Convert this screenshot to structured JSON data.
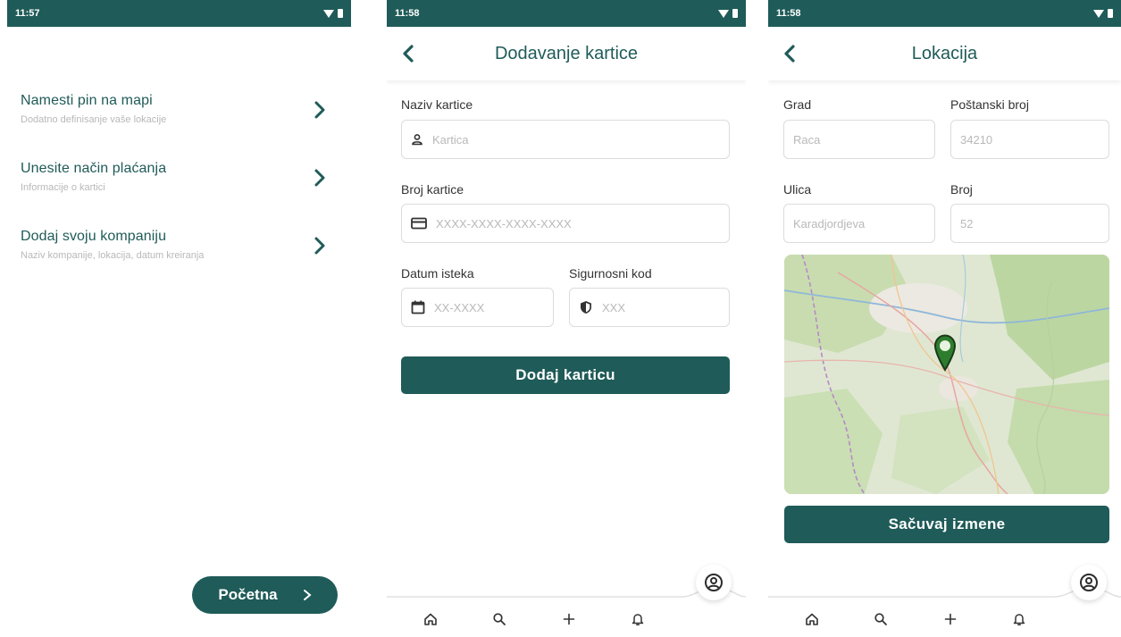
{
  "screen1": {
    "status_time": "11:57",
    "items": [
      {
        "title": "Namesti pin na mapi",
        "subtitle": "Dodatno definisanje vaše lokacije"
      },
      {
        "title": "Unesite način plaćanja",
        "subtitle": "Informacije o kartici"
      },
      {
        "title": "Dodaj svoju kompaniju",
        "subtitle": "Naziv kompanije, lokacija, datum kreiranja"
      }
    ],
    "home_button": "Početna"
  },
  "screen2": {
    "status_time": "11:58",
    "title": "Dodavanje kartice",
    "card_name_label": "Naziv kartice",
    "card_name_placeholder": "Kartica",
    "card_number_label": "Broj kartice",
    "card_number_placeholder": "XXXX-XXXX-XXXX-XXXX",
    "expiry_label": "Datum isteka",
    "expiry_placeholder": "XX-XXXX",
    "cvv_label": "Sigurnosni kod",
    "cvv_placeholder": "XXX",
    "submit_label": "Dodaj karticu"
  },
  "screen3": {
    "status_time": "11:58",
    "title": "Lokacija",
    "city_label": "Grad",
    "city_value": "Raca",
    "zip_label": "Poštanski broj",
    "zip_value": "34210",
    "street_label": "Ulica",
    "street_value": "Karadjordjeva",
    "number_label": "Broj",
    "number_value": "52",
    "save_label": "Sačuvaj izmene"
  },
  "colors": {
    "primary": "#1f5b58",
    "subtitle_gray": "#b8b8b8",
    "border": "#dcdcdc"
  },
  "icons": [
    "wifi-icon",
    "battery-icon",
    "chevron-right-icon",
    "chevron-left-icon",
    "user-icon",
    "credit-card-icon",
    "calendar-icon",
    "shield-icon",
    "home-icon",
    "search-icon",
    "plus-icon",
    "bell-icon",
    "profile-icon",
    "map-pin-icon"
  ]
}
